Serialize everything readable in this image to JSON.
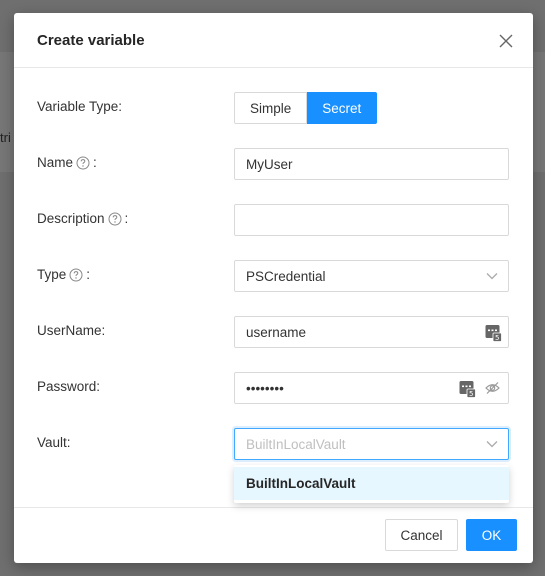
{
  "background": {
    "fragment_text": "tri"
  },
  "dialog": {
    "title": "Create variable",
    "fields": {
      "variable_type": {
        "label": "Variable Type:",
        "options": [
          "Simple",
          "Secret"
        ],
        "selected": "Secret"
      },
      "name": {
        "label": "Name",
        "colon": ":",
        "value": "MyUser"
      },
      "description": {
        "label": "Description",
        "colon": ":",
        "value": ""
      },
      "type": {
        "label": "Type",
        "colon": ":",
        "value": "PSCredential"
      },
      "username": {
        "label": "UserName:",
        "value": "username"
      },
      "password": {
        "label": "Password:",
        "value": "••••••••"
      },
      "vault": {
        "label": "Vault:",
        "placeholder": "BuiltInLocalVault",
        "options": [
          "BuiltInLocalVault"
        ]
      }
    },
    "footer": {
      "cancel_label": "Cancel",
      "ok_label": "OK"
    }
  },
  "colors": {
    "primary": "#1890ff",
    "dropdown_hover": "#e6f7ff",
    "border": "#d9d9d9"
  },
  "icons": [
    "close-icon",
    "help-icon",
    "chevron-down-icon",
    "variable-picker-icon",
    "eye-slash-icon"
  ]
}
